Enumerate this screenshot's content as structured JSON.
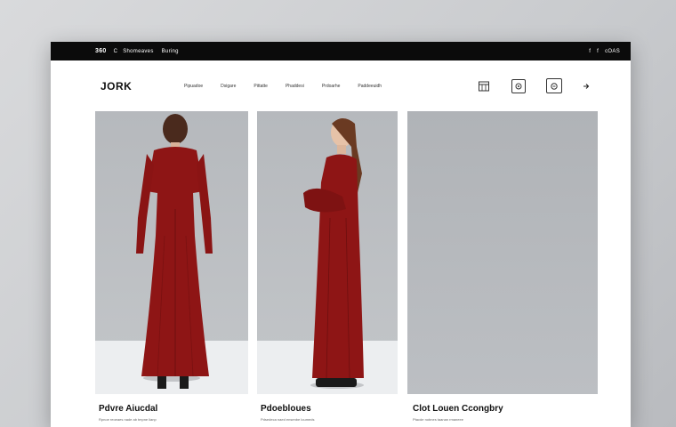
{
  "topbar": {
    "items": [
      "360",
      "C",
      "Shomeaves",
      "Buring"
    ],
    "right": [
      "f",
      "f",
      "cOAS"
    ]
  },
  "brand": "JORK",
  "nav": [
    "Pipuadoe",
    "Dsigare",
    "Pittatte",
    "Phaddesi",
    "Prdoarhe",
    "Paddeeuidh"
  ],
  "products": [
    {
      "title": "Pdvre Aiucdal",
      "subtitle": "Rpnoe reoeaes nade ab tmpne lianp"
    },
    {
      "title": "Pdoebloues",
      "subtitle": "Pdsedeca naed ensenbe loumeds"
    },
    {
      "title": "Clot Louen Ccongbry",
      "subtitle": "Ptacde nobnes taanan rmaneee"
    }
  ],
  "colors": {
    "dress": "#8e1515",
    "topbar": "#0b0b0b",
    "card_bg": "#b9bcc0"
  }
}
